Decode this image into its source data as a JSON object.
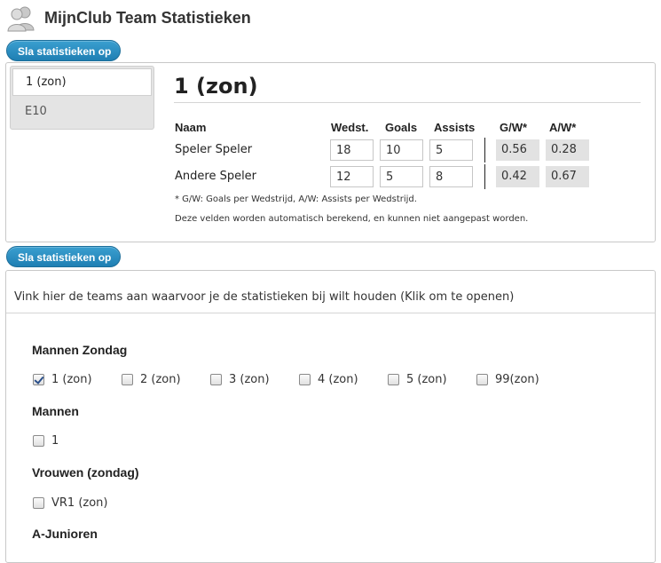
{
  "header": {
    "title": "MijnClub Team Statistieken",
    "logo_icon": "users-icon"
  },
  "actions": {
    "save_label": "Sla statistieken op"
  },
  "team_list": [
    {
      "label": "1 (zon)",
      "active": true
    },
    {
      "label": "E10",
      "active": false
    }
  ],
  "stats": {
    "title": "1 (zon)",
    "columns": {
      "name": "Naam",
      "matches": "Wedst.",
      "goals": "Goals",
      "assists": "Assists",
      "gw": "G/W*",
      "aw": "A/W*"
    },
    "players": [
      {
        "name": "Speler Speler",
        "matches": "18",
        "goals": "10",
        "assists": "5",
        "gw": "0.56",
        "aw": "0.28"
      },
      {
        "name": "Andere Speler",
        "matches": "12",
        "goals": "5",
        "assists": "8",
        "gw": "0.42",
        "aw": "0.67"
      }
    ],
    "footnote": "* G/W: Goals per Wedstrijd, A/W: Assists per Wedstrijd.",
    "autocalc_note": "Deze velden worden automatisch berekend, en kunnen niet aangepast worden."
  },
  "team_selection": {
    "instruction": "Vink hier de teams aan waarvoor je de statistieken bij wilt houden (Klik om te openen)",
    "groups": [
      {
        "name": "Mannen Zondag",
        "teams": [
          {
            "label": "1 (zon)",
            "checked": true
          },
          {
            "label": "2 (zon)",
            "checked": false
          },
          {
            "label": "3 (zon)",
            "checked": false
          },
          {
            "label": "4 (zon)",
            "checked": false
          },
          {
            "label": "5 (zon)",
            "checked": false
          },
          {
            "label": "99(zon)",
            "checked": false
          }
        ]
      },
      {
        "name": "Mannen",
        "teams": [
          {
            "label": "1",
            "checked": false
          }
        ]
      },
      {
        "name": "Vrouwen (zondag)",
        "teams": [
          {
            "label": "VR1 (zon)",
            "checked": false
          }
        ]
      },
      {
        "name": "A-Junioren",
        "teams": []
      }
    ]
  }
}
